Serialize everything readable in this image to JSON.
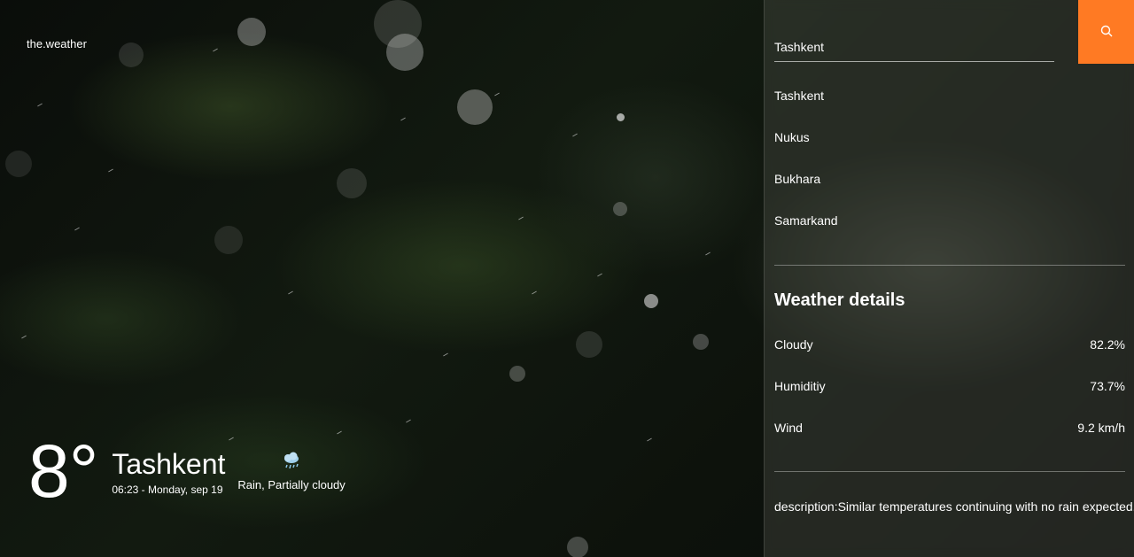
{
  "app": {
    "logo": "the.weather"
  },
  "current": {
    "temperature": "8°",
    "city": "Tashkent",
    "datetime": "06:23 - Monday, sep 19",
    "condition_icon": "rain-cloud-icon",
    "condition": "Rain, Partially cloudy"
  },
  "search": {
    "value": "Tashkent",
    "icon": "search-icon",
    "button_color": "#ff7a23"
  },
  "cities": [
    "Tashkent",
    "Nukus",
    "Bukhara",
    "Samarkand"
  ],
  "details": {
    "title": "Weather details",
    "rows": [
      {
        "label": "Cloudy",
        "value": "82.2%"
      },
      {
        "label": "Humiditiy",
        "value": "73.7%"
      },
      {
        "label": "Wind",
        "value": "9.2 km/h"
      }
    ],
    "description": "description:Similar temperatures continuing with no rain expected."
  }
}
